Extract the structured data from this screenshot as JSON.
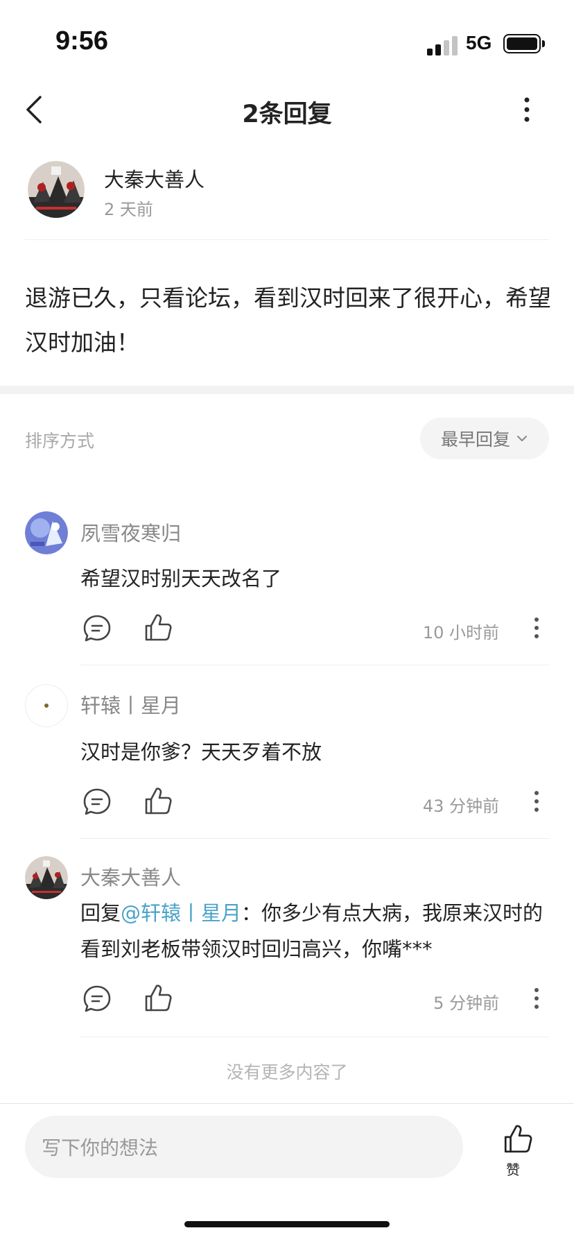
{
  "status_bar": {
    "time": "9:56",
    "network": "5G"
  },
  "nav": {
    "title": "2条回复",
    "back_icon": "chevron-left-icon",
    "more_icon": "more-vertical-icon"
  },
  "post": {
    "author": "大秦大善人",
    "time": "2 天前",
    "content": "退游已久，只看论坛，看到汉时回来了很开心，希望汉时加油！"
  },
  "sort": {
    "label": "排序方式",
    "selected": "最早回复"
  },
  "replies": [
    {
      "author": "夙雪夜寒归",
      "text": "希望汉时别天天改名了",
      "time": "10 小时前"
    },
    {
      "author": "轩辕丨星月",
      "text": "汉时是你爹？天天歹着不放",
      "time": "43 分钟前"
    },
    {
      "author": "大秦大善人",
      "reply_prefix": "回复",
      "mention": "@轩辕丨星月",
      "text": "：你多少有点大病，我原来汉时的看到刘老板带领汉时回归高兴，你嘴***",
      "time": "5 分钟前"
    }
  ],
  "footer": {
    "end_text": "没有更多内容了"
  },
  "bottom_bar": {
    "input_placeholder": "写下你的想法",
    "like_label": "赞"
  },
  "colors": {
    "mention": "#4aa3c9",
    "muted_text": "#999999",
    "primary_text": "#222222"
  }
}
